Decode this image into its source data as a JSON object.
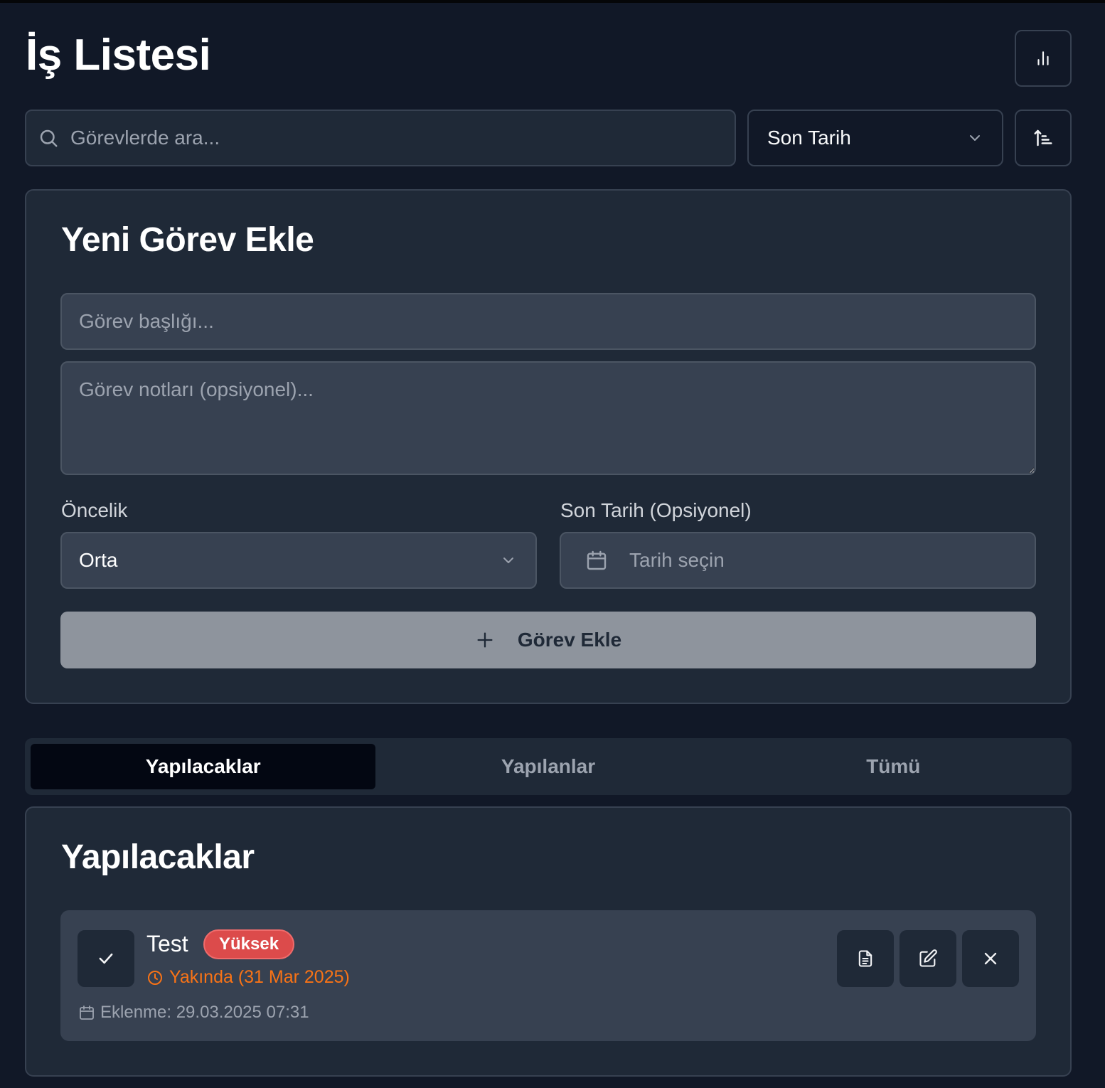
{
  "header": {
    "title": "İş Listesi",
    "stats_icon": "bar-chart-icon"
  },
  "toolbar": {
    "search_placeholder": "Görevlerde ara...",
    "sort_selected": "Son Tarih",
    "sort_direction_icon": "sort-ascending-icon"
  },
  "new_task": {
    "heading": "Yeni Görev Ekle",
    "title_placeholder": "Görev başlığı...",
    "notes_placeholder": "Görev notları (opsiyonel)...",
    "priority_label": "Öncelik",
    "priority_selected": "Orta",
    "due_label": "Son Tarih (Opsiyonel)",
    "due_placeholder": "Tarih seçin",
    "add_button": "Görev Ekle"
  },
  "tabs": [
    {
      "label": "Yapılacaklar",
      "active": true
    },
    {
      "label": "Yapılanlar",
      "active": false
    },
    {
      "label": "Tümü",
      "active": false
    }
  ],
  "list": {
    "heading": "Yapılacaklar",
    "tasks": [
      {
        "title": "Test",
        "priority": "Yüksek",
        "due_text": "Yakında (31 Mar 2025)",
        "created_text": "Eklenme: 29.03.2025 07:31"
      }
    ]
  },
  "colors": {
    "background": "#111827",
    "card": "#1f2937",
    "field": "#374151",
    "priority_high": "#dc4b4b",
    "due_soon": "#f97316",
    "active_tab": "#030712"
  }
}
